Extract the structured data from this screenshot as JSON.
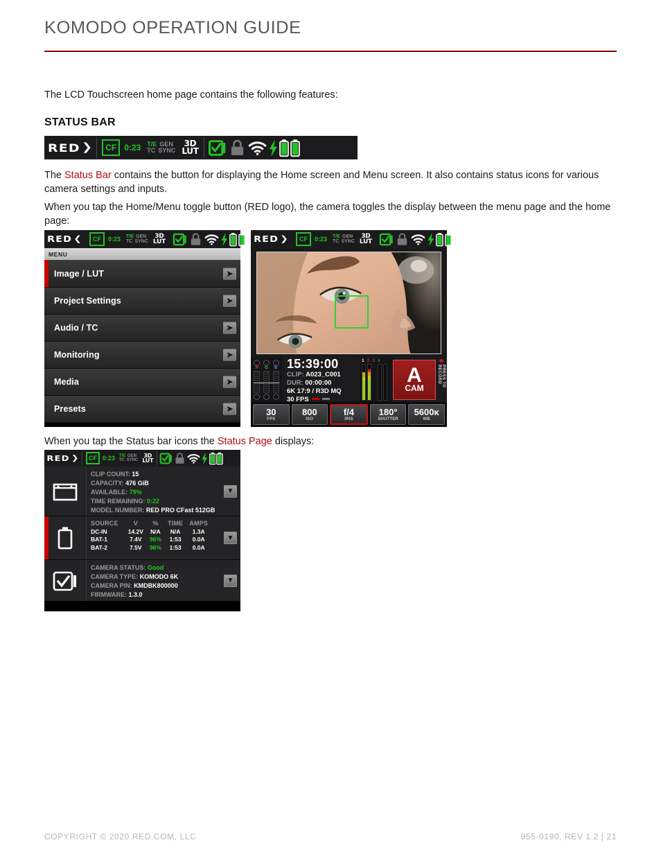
{
  "header": {
    "title": "KOMODO OPERATION GUIDE",
    "rule_color": "#8b0000"
  },
  "intro": {
    "text": "The LCD Touchscreen home page contains the following features:"
  },
  "section": {
    "heading": "STATUS BAR"
  },
  "paragraphs": {
    "p1_a": "The ",
    "p1_term": "Status Bar",
    "p1_b": " contains the button for displaying the Home screen and Menu screen. It also contains status icons for various camera settings and inputs.",
    "p2": "When you tap the Home/Menu toggle button (RED logo), the camera toggles the display between the menu page and the home page:",
    "p3_a": "When you tap the Status bar icons the ",
    "p3_term": "Status Page",
    "p3_b": " displays:"
  },
  "status_bar": {
    "logo": "RED",
    "arrow_home": "➤",
    "arrow_menu": "➤",
    "card_label": "CF",
    "card_time": "0:23",
    "te": "T/E",
    "gen": "GEN",
    "tc": "TC",
    "sync": "SYNC",
    "lut_top": "3D",
    "lut_bottom": "LUT",
    "icons": [
      "check-card-icon",
      "lock-icon",
      "wifi-icon",
      "bolt-icon",
      "battery-icon",
      "battery-icon"
    ],
    "colors": {
      "green": "#24c424",
      "gray": "#8d8d8f",
      "bar_bg": "#1b1b1d"
    }
  },
  "menu_screen": {
    "label": "MENU",
    "items": [
      {
        "label": "Image / LUT",
        "selected": true
      },
      {
        "label": "Project Settings",
        "selected": false
      },
      {
        "label": "Audio / TC",
        "selected": false
      },
      {
        "label": "Monitoring",
        "selected": false
      },
      {
        "label": "Media",
        "selected": false
      },
      {
        "label": "Presets",
        "selected": false
      }
    ],
    "chevron": "➤"
  },
  "home_screen": {
    "timecode": "15:39:00",
    "clip_key": "CLIP:",
    "clip_value": "A023_C001",
    "dur_key": "DUR:",
    "dur_value": "00:00:00",
    "format": "6K 17:9 / R3D MQ",
    "fps_line": "30 FPS",
    "histogram_labels": [
      "R",
      "G",
      "B"
    ],
    "audio_channels": [
      "1",
      "2",
      "3",
      "4"
    ],
    "record_letter": "A",
    "record_word": "CAM",
    "record_hint": "PRESS TO RECORD",
    "controls": [
      {
        "value": "30",
        "unit": "FPS",
        "selected": false
      },
      {
        "value": "800",
        "unit": "ISO",
        "selected": false
      },
      {
        "value": "f/4",
        "unit": "IRIS",
        "selected": true
      },
      {
        "value": "180°",
        "unit": "SHUTTER",
        "selected": false
      },
      {
        "value": "5600ᴋ",
        "unit": "WB",
        "selected": false
      }
    ]
  },
  "status_page": {
    "media": {
      "icon": "media-card-icon",
      "lines": [
        {
          "key": "CLIP COUNT:",
          "value": "15",
          "green": false
        },
        {
          "key": "CAPACITY:",
          "value": "476 GiB",
          "green": false
        },
        {
          "key": "AVAILABLE:",
          "value": "79%",
          "green": true
        },
        {
          "key": "TIME REMAINING:",
          "value": "0:22",
          "green": true
        },
        {
          "key": "MODEL NUMBER:",
          "value": "RED PRO CFast 512GB",
          "green": false
        }
      ]
    },
    "power": {
      "icon": "battery-icon",
      "headers": [
        "SOURCE",
        "V",
        "%",
        "TIME",
        "AMPS"
      ],
      "rows": [
        {
          "source": "DC-IN",
          "v": "14.2V",
          "pct": "N/A",
          "pct_green": false,
          "time": "N/A",
          "amps": "1.3A"
        },
        {
          "source": "BAT-1",
          "v": "7.4V",
          "pct": "96%",
          "pct_green": true,
          "time": "1:53",
          "amps": "0.0A"
        },
        {
          "source": "BAT-2",
          "v": "7.5V",
          "pct": "96%",
          "pct_green": true,
          "time": "1:53",
          "amps": "0.0A"
        }
      ]
    },
    "camera": {
      "icon": "camera-check-icon",
      "lines": [
        {
          "key": "CAMERA STATUS:",
          "value": "Good",
          "green": true
        },
        {
          "key": "CAMERA TYPE:",
          "value": "KOMODO 6K",
          "green": false
        },
        {
          "key": "CAMERA PIN:",
          "value": "KMDBK800000",
          "green": false
        },
        {
          "key": "FIRMWARE:",
          "value": "1.3.0",
          "green": false
        }
      ]
    },
    "chevron": "▼"
  },
  "footer": {
    "left": "COPYRIGHT © 2020 RED.COM, LLC",
    "right": "955-0190, REV 1.2  |  21"
  }
}
